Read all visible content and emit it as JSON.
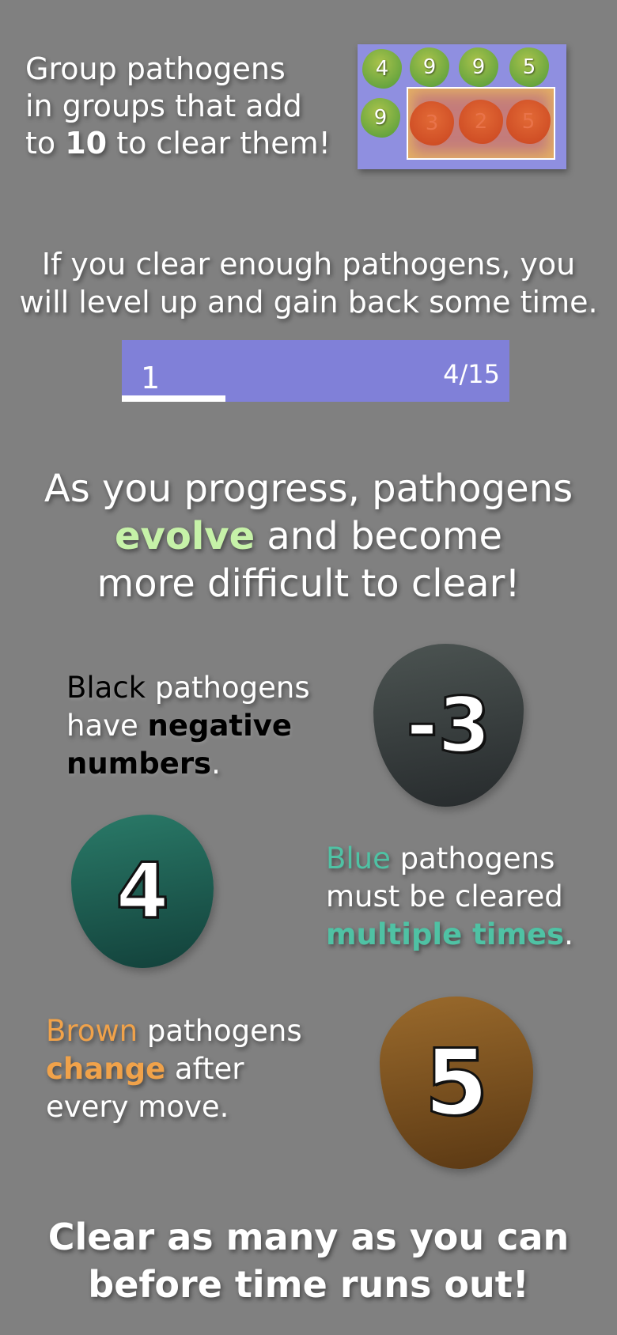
{
  "intro": {
    "line1": "Group pathogens",
    "line2": "in groups that add",
    "line3_pre": "to ",
    "line3_bold": "10",
    "line3_post": " to clear them!"
  },
  "demo_board": {
    "cells": [
      {
        "value": "4",
        "color": "green"
      },
      {
        "value": "9",
        "color": "green"
      },
      {
        "value": "9",
        "color": "green"
      },
      {
        "value": "5",
        "color": "green"
      },
      {
        "value": "9",
        "color": "green"
      },
      {
        "value": "3",
        "color": "red"
      },
      {
        "value": "2",
        "color": "red"
      },
      {
        "value": "5",
        "color": "red"
      }
    ]
  },
  "level_text": {
    "line1": "If you clear enough pathogens, you",
    "line2": "will level up and gain back some time."
  },
  "level_bar": {
    "level": "1",
    "progress_text": "4/15",
    "progress_fraction": 0.267,
    "bar_color": "#8080d8"
  },
  "evolve": {
    "line1": "As you progress, pathogens",
    "highlight": "evolve",
    "line2_post": " and become",
    "line3": "more difficult to clear!",
    "highlight_color": "#c6f2a8"
  },
  "black_pathogen": {
    "name": "Black",
    "line1_post": " pathogens",
    "line2_pre": "have ",
    "line2_bold": "negative",
    "line3_bold": "numbers",
    "line3_post": ".",
    "value": "-3",
    "color": "#000000"
  },
  "blue_pathogen": {
    "name": "Blue",
    "line1_post": " pathogens",
    "line2": "must be cleared",
    "line3_bold": "multiple times",
    "line3_post": ".",
    "value": "4",
    "color": "#4fc2a4"
  },
  "brown_pathogen": {
    "name": "Brown",
    "line1_post": " pathogens",
    "line2_bold": "change",
    "line2_post": " after",
    "line3": "every move.",
    "value": "5",
    "color": "#f0a24a"
  },
  "outro": {
    "line1": "Clear as many as you can",
    "line2": "before time runs out!"
  }
}
